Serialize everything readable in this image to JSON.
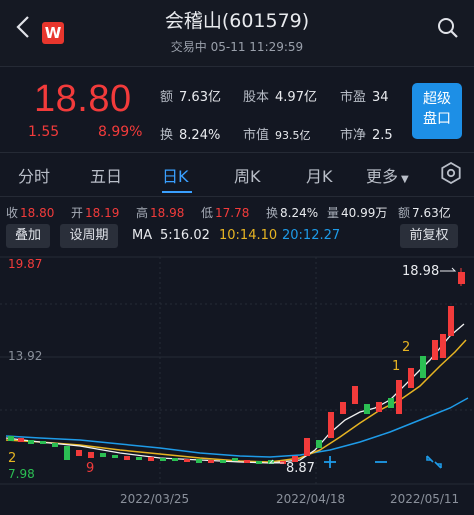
{
  "header": {
    "title": "会稽山(601579)",
    "subtitle": "交易中 05-11 11:29:59",
    "logo_text": "W"
  },
  "quote": {
    "price": "18.80",
    "change": "1.55",
    "change_pct": "8.99%",
    "amount_label": "额",
    "amount": "7.63亿",
    "turnover_label": "换",
    "turnover": "8.24%",
    "shares_label": "股本",
    "shares": "4.97亿",
    "mktcap_label": "市值",
    "mktcap": "93.5亿",
    "pe_label": "市盈",
    "pe": "34",
    "pb_label": "市净",
    "pb": "2.5",
    "level2_label_line1": "超级",
    "level2_label_line2": "盘口"
  },
  "tabs": [
    "分时",
    "五日",
    "日K",
    "周K",
    "月K",
    "更多"
  ],
  "active_tab": "日K",
  "ohlc": {
    "close_label": "收",
    "close": "18.80",
    "open_label": "开",
    "open": "18.19",
    "high_label": "高",
    "high": "18.98",
    "low_label": "低",
    "low": "17.78",
    "turnover_label": "换",
    "turnover": "8.24%",
    "volume_label": "量",
    "volume": "40.99万",
    "amount_label": "额",
    "amount": "7.63亿"
  },
  "toolbar": {
    "overlay": "叠加",
    "set_period": "设周期",
    "adjust": "前复权",
    "ma_label": "MA",
    "ma5": "5:16.02",
    "ma10": "10:14.10",
    "ma20": "20:12.27"
  },
  "chart_data": {
    "type": "candlestick",
    "y_max_label": "19.87",
    "y_mid_label": "13.92",
    "y_min_label": "7.98",
    "high_annotation": "18.98",
    "low_annotation": "8.87",
    "x_labels": [
      "2022/03/25",
      "2022/04/18",
      "2022/05/11"
    ],
    "markers": [
      {
        "text": "2",
        "color": "#e6b422"
      },
      {
        "text": "9",
        "color": "#f23b3b"
      },
      {
        "text": "2",
        "color": "#e6b422"
      },
      {
        "text": "1",
        "color": "#e6b422"
      }
    ],
    "colors": {
      "up": "#f23b3b",
      "down": "#2bbf53",
      "ma5": "#f2f2f2",
      "ma10": "#e6b422",
      "ma20": "#1e9be8"
    }
  }
}
